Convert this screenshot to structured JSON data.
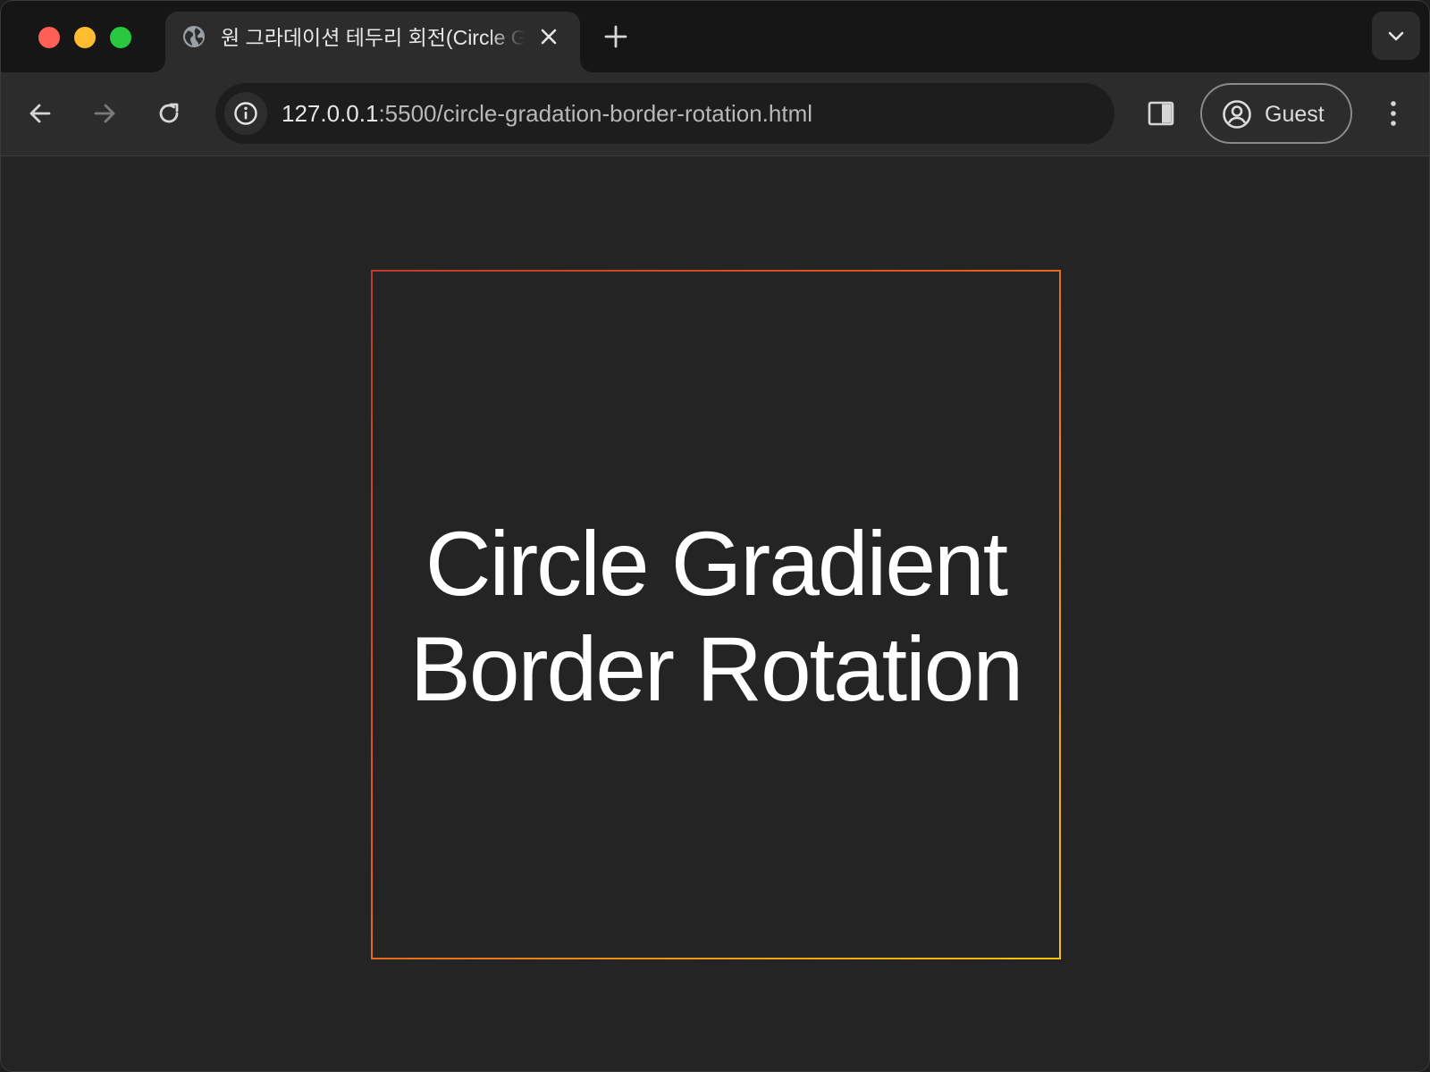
{
  "tab": {
    "title": "원 그라데이션 테두리 회전(Circle Gradation Border Rotation)",
    "favicon": "globe-icon",
    "close_icon": "close-icon"
  },
  "tabstrip": {
    "new_tab_icon": "plus-icon",
    "tab_search_icon": "chevron-down-icon"
  },
  "toolbar": {
    "back_icon": "arrow-left-icon",
    "forward_icon": "arrow-right-icon",
    "reload_icon": "reload-icon",
    "url_host": "127.0.0.1",
    "url_rest": ":5500/circle-gradation-border-rotation.html",
    "site_info_icon": "info-icon",
    "side_panel_icon": "side-panel-icon",
    "profile_label": "Guest",
    "profile_icon": "user-circle-icon",
    "menu_icon": "kebab-menu-icon"
  },
  "page": {
    "headline_line1": "Circle Gradient",
    "headline_line2": "Border Rotation"
  },
  "colors": {
    "border_gradient_start": "#c0392b",
    "border_gradient_end": "#f5c211",
    "background": "#242424",
    "text": "#ffffff"
  }
}
